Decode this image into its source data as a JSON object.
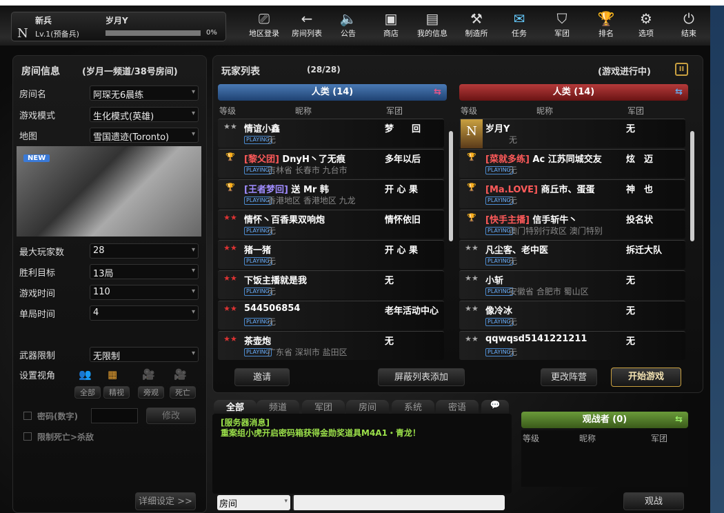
{
  "profile": {
    "rank_title": "新兵",
    "name": "岁月Y",
    "level": "Lv.1(预备兵)",
    "exp_percent": "0%",
    "exp_fraction": 0,
    "badge": "N"
  },
  "nav": [
    {
      "label": "地区登录",
      "icon": "region-login-icon",
      "glyph": "⎚"
    },
    {
      "label": "房间列表",
      "icon": "back-arrow-icon",
      "glyph": "←"
    },
    {
      "label": "公告",
      "icon": "speaker-icon",
      "glyph": "🔈"
    },
    {
      "label": "商店",
      "icon": "shop-icon",
      "glyph": "▣"
    },
    {
      "label": "我的信息",
      "icon": "id-card-icon",
      "glyph": "▤"
    },
    {
      "label": "制造所",
      "icon": "hammer-icon",
      "glyph": "⚒"
    },
    {
      "label": "任务",
      "icon": "scroll-icon",
      "glyph": "✉"
    },
    {
      "label": "军团",
      "icon": "shield-icon",
      "glyph": "⛉"
    },
    {
      "label": "排名",
      "icon": "trophy-icon",
      "glyph": "🏆"
    },
    {
      "label": "选项",
      "icon": "gear-icon",
      "glyph": "⚙"
    },
    {
      "label": "结束",
      "icon": "power-icon",
      "glyph": "⏻"
    }
  ],
  "room": {
    "title": "房间信息",
    "subtitle": "(岁月一频道/38号房间)",
    "fields": [
      {
        "label": "房间名",
        "value": "阿琛无6晨练"
      },
      {
        "label": "游戏模式",
        "value": "生化模式(英雄)"
      },
      {
        "label": "地图",
        "value": "雪国遗迹(Toronto)"
      },
      {
        "label": "最大玩家数",
        "value": "28"
      },
      {
        "label": "胜利目标",
        "value": "13局"
      },
      {
        "label": "游戏时间",
        "value": "110"
      },
      {
        "label": "单局时间",
        "value": "4"
      },
      {
        "label": "武器限制",
        "value": "无限制"
      }
    ],
    "map_badge": "NEW",
    "view_label": "设置视角",
    "views": [
      "全部",
      "精视",
      "旁观",
      "死亡"
    ],
    "password_label": "密码(数字)",
    "modify": "修改",
    "limit_label": "限制死亡>杀敌",
    "detail": "详细设定 >>"
  },
  "players": {
    "title": "玩家列表",
    "count": "(28/28)",
    "status": "(游戏进行中)",
    "columns": [
      "等级",
      "昵称",
      "军团"
    ],
    "human_label": "人类 (14)",
    "zombie_label": "人类 (14)",
    "left": [
      {
        "name": "情谊小鑫",
        "clan": "梦　　回",
        "loc": "无",
        "playing": "PLAYING"
      },
      {
        "tag": "[黎父团]",
        "tagColor": "#ff5a5a",
        "name": "DnyH丶了无痕",
        "clan": "多年以后",
        "loc": "吉林省 长春市 九台市",
        "playing": "PLAYING"
      },
      {
        "tag": "[王者梦回]",
        "tagColor": "#a08cff",
        "name": "送 Mr 韩",
        "clan": "开 心 果",
        "loc": "香港地区 香港地区 九龙",
        "playing": "PLAYING"
      },
      {
        "name": "情怀丶百香果双响炮",
        "clan": "情怀依旧",
        "loc": "无",
        "playing": "PLAYING"
      },
      {
        "name": "猪一猪",
        "clan": "开 心 果",
        "loc": "无",
        "playing": "PLAYING"
      },
      {
        "name": "下饭主播就是我",
        "clan": "无",
        "loc": "无",
        "playing": "PLAYING"
      },
      {
        "name": "544506854",
        "clan": "老年活动中心",
        "loc": "无",
        "playing": "PLAYING"
      },
      {
        "name": "茶壶炮",
        "clan": "无",
        "loc": "广东省 深圳市 盐田区",
        "playing": "PLAYING"
      }
    ],
    "right": [
      {
        "name": "岁月Y",
        "clan": "无",
        "loc": "无",
        "playing": ""
      },
      {
        "tag": "[菜就多练]",
        "tagColor": "#ff5a5a",
        "name": "Ac 江苏同城交友",
        "clan": "炫　迈",
        "loc": "无",
        "playing": "PLAYING"
      },
      {
        "tag": "[Ma.LOVE]",
        "tagColor": "#ff5a5a",
        "name": "商丘市、蛋蛋",
        "clan": "神　也",
        "loc": "无",
        "playing": "PLAYING"
      },
      {
        "tag": "[快手主播]",
        "tagColor": "#ff5a5a",
        "name": "信手斩牛丶",
        "clan": "投名状",
        "loc": "澳门特别行政区 澳门特别",
        "playing": "PLAYING"
      },
      {
        "name": "凡尘客、老中医",
        "clan": "拆迁大队",
        "loc": "无",
        "playing": "PLAYING"
      },
      {
        "name": "小斩",
        "clan": "无",
        "loc": "安徽省 合肥市 蜀山区",
        "playing": "PLAYING"
      },
      {
        "name": "像冷冰",
        "clan": "无",
        "loc": "无",
        "playing": "PLAYING"
      },
      {
        "name": "qqwqsd5141221211",
        "clan": "无",
        "loc": "无",
        "playing": "PLAYING"
      }
    ],
    "buttons": {
      "invite": "邀请",
      "block": "屏蔽列表添加",
      "change_team": "更改阵营",
      "start": "开始游戏"
    }
  },
  "chat": {
    "tabs": [
      "全部",
      "频道",
      "军团",
      "房间",
      "系统",
      "密语"
    ],
    "messages": [
      "[服务器消息]",
      "重案组小虎开启密码箱获得金勋奖道具M4A1・青龙！"
    ],
    "channel": "房间",
    "input": ""
  },
  "spectator": {
    "title": "观战者 (0)",
    "columns": [
      "等级",
      "昵称",
      "军团"
    ],
    "button": "观战"
  },
  "colors": {
    "human_blue": "#2d5a8c",
    "zombie_red": "#8c1e1e",
    "spectator_green": "#4f7a2a",
    "chat_green": "#9be04a"
  }
}
